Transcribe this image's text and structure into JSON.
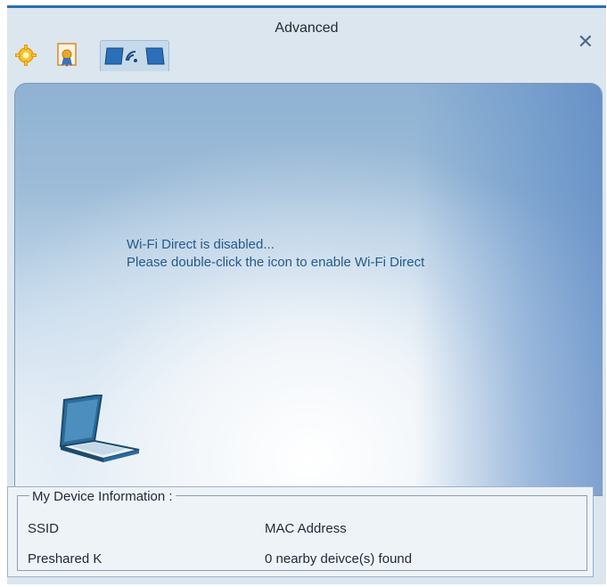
{
  "window": {
    "title": "Advanced"
  },
  "tabs": [
    {
      "icon": "settings-gear-icon"
    },
    {
      "icon": "certificate-icon"
    },
    {
      "icon": "wifi-direct-icon",
      "active": true
    }
  ],
  "main": {
    "message_line1": "Wi-Fi Direct is disabled...",
    "message_line2": "Please double-click the icon to enable Wi-Fi Direct"
  },
  "device_info": {
    "legend": "My Device Information :",
    "ssid_label": "SSID",
    "mac_label": "MAC Address",
    "preshared_label": "Preshared K",
    "nearby": "0 nearby deivce(s) found"
  },
  "colors": {
    "title_border": "#2a6fb0",
    "message_text": "#245a8c",
    "panel_blue": "#8fb2d3"
  }
}
